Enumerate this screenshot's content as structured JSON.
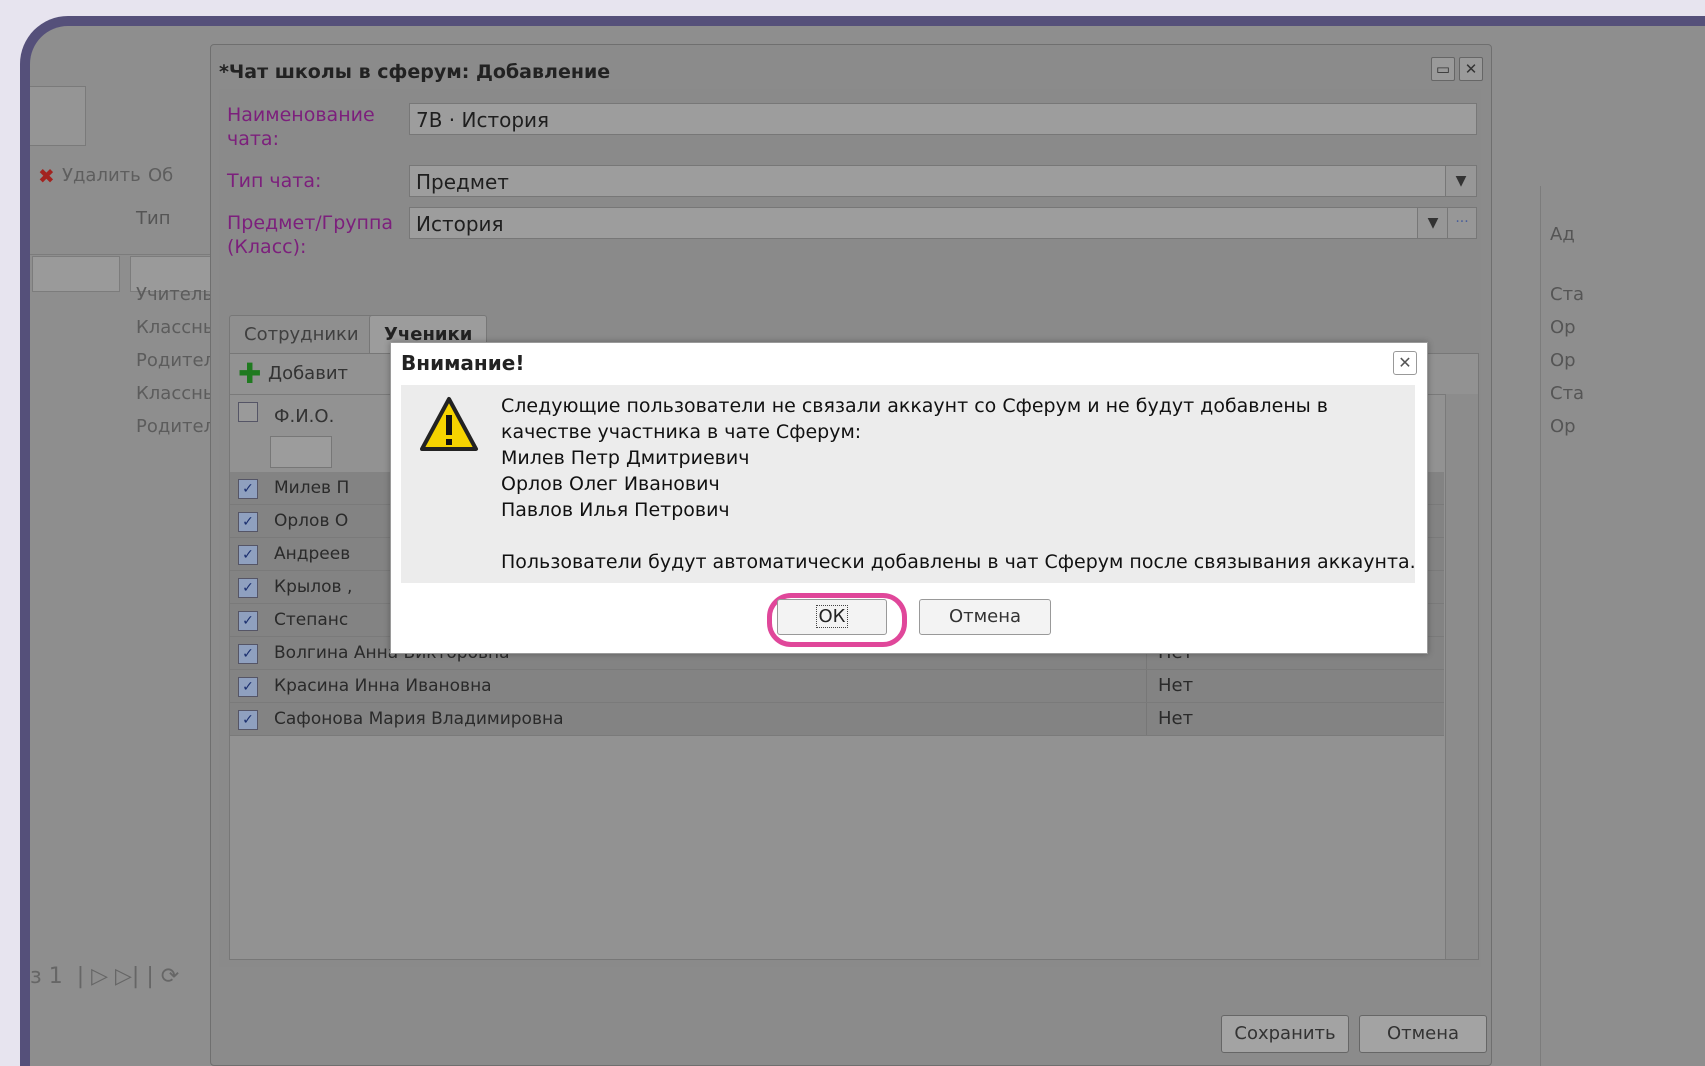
{
  "background": {
    "toolbar_delete": "Удалить",
    "toolbar_refresh": "Об",
    "col_type": "Тип",
    "rows": [
      "Учитель",
      "Классны",
      "Родител",
      "Классны",
      "Родител"
    ],
    "right_col_header": "Ад",
    "right_col_rows": [
      "Ста",
      "Ор",
      "Ор",
      "Ста",
      "Ор"
    ],
    "pager_text": "з 1"
  },
  "dialog": {
    "title": "*Чат школы в сферум: Добавление",
    "fields": {
      "name_label": "Наименование чата:",
      "name_value": "7В · История",
      "type_label": "Тип чата:",
      "type_value": "Предмет",
      "subject_label": "Предмет/Группа (Класс):",
      "subject_value": "История"
    },
    "tabs": [
      "Сотрудники",
      "Ученики"
    ],
    "grid": {
      "add_label": "Добавит",
      "col_fio": "Ф.И.О.",
      "rows": [
        {
          "name": "Милев П",
          "value": ""
        },
        {
          "name": "Орлов О",
          "value": ""
        },
        {
          "name": "Андреев",
          "value": ""
        },
        {
          "name": "Крылов ,",
          "value": ""
        },
        {
          "name": "Степанс",
          "value": ""
        },
        {
          "name": "Волгина Анна Викторовна",
          "value": "Нет"
        },
        {
          "name": "Красина Инна Ивановна",
          "value": "Нет"
        },
        {
          "name": "Сафонова Мария Владимировна",
          "value": "Нет"
        }
      ]
    },
    "save_label": "Сохранить",
    "cancel_label": "Отмена"
  },
  "modal": {
    "title": "Внимание!",
    "lines": [
      "Следующие пользователи не связали аккаунт со Сферум и не будут добавлены в",
      "качестве участника в чате Сферум:",
      "Милев Петр Дмитриевич",
      "Орлов Олег Иванович",
      "Павлов Илья Петрович"
    ],
    "footer_line": "Пользователи будут автоматически добавлены в чат Сферум после связывания аккаунта.",
    "ok_label": "ОК",
    "cancel_label": "Отмена"
  },
  "colors": {
    "frame": "#55507a",
    "highlight": "#e0479a",
    "label_purple": "#7c1f7c"
  }
}
